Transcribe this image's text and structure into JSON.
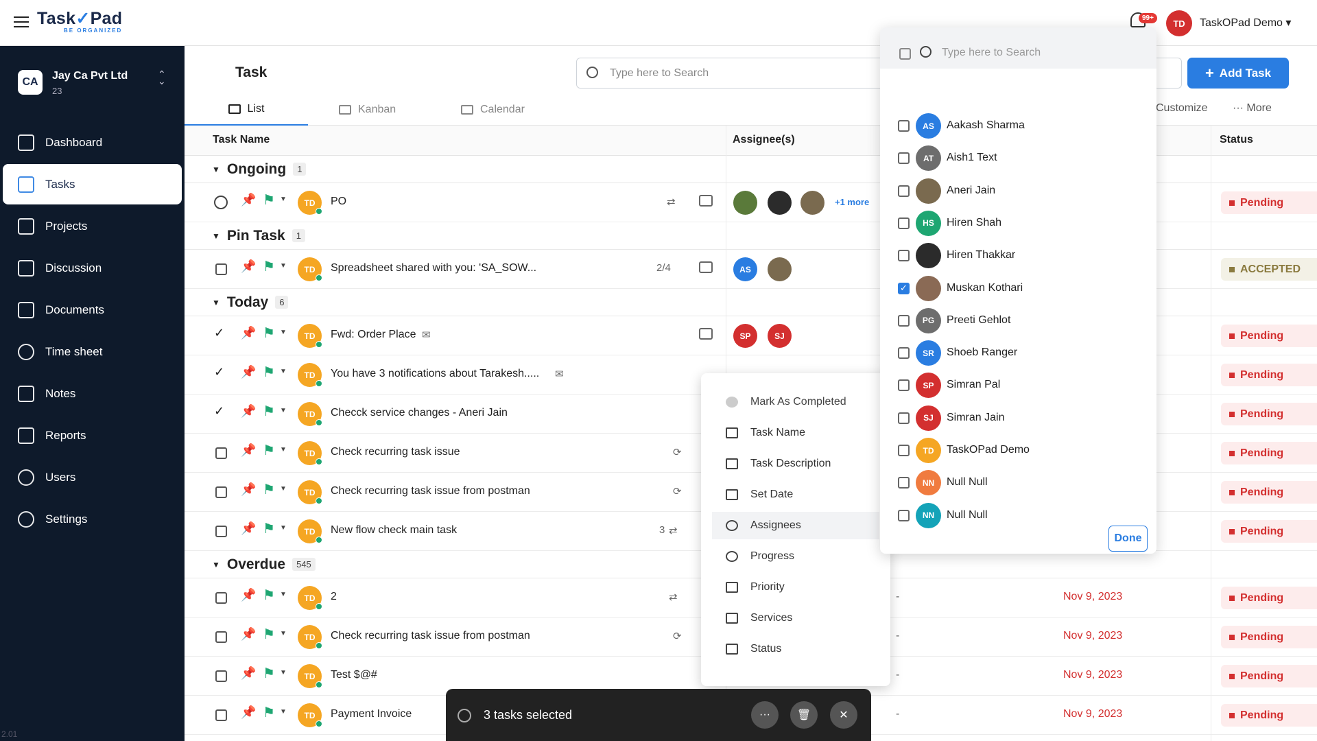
{
  "app": {
    "name_part1": "Task",
    "name_part2": "Pad",
    "tagline": "BE ORGANIZED",
    "version": "2.01"
  },
  "header": {
    "notification_badge": "99+",
    "user_initials": "TD",
    "user_name": "TaskOPad Demo ▾"
  },
  "sidebar": {
    "org_initials": "CA",
    "org_name": "Jay Ca Pvt Ltd",
    "org_count": "23",
    "items": [
      {
        "label": "Dashboard",
        "icon": "dashboard-icon"
      },
      {
        "label": "Tasks",
        "icon": "tasks-icon"
      },
      {
        "label": "Projects",
        "icon": "projects-icon"
      },
      {
        "label": "Discussion",
        "icon": "discussion-icon"
      },
      {
        "label": "Documents",
        "icon": "folder-icon"
      },
      {
        "label": "Time sheet",
        "icon": "clock-icon"
      },
      {
        "label": "Notes",
        "icon": "notes-icon"
      },
      {
        "label": "Reports",
        "icon": "reports-icon"
      },
      {
        "label": "Users",
        "icon": "users-icon"
      },
      {
        "label": "Settings",
        "icon": "gear-icon"
      }
    ]
  },
  "page": {
    "title": "Task",
    "search_placeholder": "Type here to Search",
    "add_task": "Add Task",
    "tabs": [
      "List",
      "Kanban",
      "Calendar"
    ],
    "customize": "Customize",
    "more": "··· More"
  },
  "columns": {
    "task_name": "Task Name",
    "assignees": "Assignee(s)",
    "status": "Status"
  },
  "groups": [
    {
      "name": "Ongoing",
      "count": "1"
    },
    {
      "name": "Pin Task",
      "count": "1"
    },
    {
      "name": "Today",
      "count": "6"
    },
    {
      "name": "Overdue",
      "count": "545"
    }
  ],
  "rows": [
    {
      "name": "PO",
      "assignee_more": "+1 more",
      "status": "Pending"
    },
    {
      "name": "Spreadsheet shared with you: 'SA_SOW...",
      "checklist": "2/4",
      "assignee1": "AS",
      "status": "ACCEPTED"
    },
    {
      "name": "Fwd: Order Place",
      "assignee1": "SP",
      "assignee2": "SJ",
      "status": "Pending"
    },
    {
      "name": "You have 3 notifications about Tarakesh.....",
      "status": "Pending"
    },
    {
      "name": "Checck service changes - Aneri Jain",
      "status": "Pending"
    },
    {
      "name": "Check recurring task issue",
      "status": "Pending"
    },
    {
      "name": "Check recurring task issue from postman",
      "status": "Pending"
    },
    {
      "name": "New flow check main task",
      "subtasks": "3",
      "status": "Pending"
    },
    {
      "name": "2",
      "dash": "-",
      "date": "Nov 9, 2023",
      "status": "Pending"
    },
    {
      "name": "Check recurring task issue from postman",
      "dash": "-",
      "date": "Nov 9, 2023",
      "status": "Pending"
    },
    {
      "name": "Test $@#",
      "dash": "-",
      "date": "Nov 9, 2023",
      "status": "Pending"
    },
    {
      "name": "Payment Invoice",
      "dash": "-",
      "date": "Nov 9, 2023",
      "status": "Pending"
    }
  ],
  "task_avatar": "TD",
  "context_menu": [
    "Mark As Completed",
    "Task Name",
    "Task Description",
    "Set Date",
    "Assignees",
    "Progress",
    "Priority",
    "Services",
    "Status"
  ],
  "assignee_popup": {
    "search_placeholder": "Type here to Search",
    "done": "Done",
    "people": [
      {
        "initials": "AS",
        "name": "Aakash Sharma",
        "color": "#2a7de1",
        "checked": false
      },
      {
        "initials": "AT",
        "name": "Aish1 Text",
        "color": "#6d6d6d",
        "checked": false
      },
      {
        "initials": "",
        "name": "Aneri Jain",
        "color": "#7a6a4f",
        "checked": false
      },
      {
        "initials": "HS",
        "name": "Hiren Shah",
        "color": "#1ea672",
        "checked": false
      },
      {
        "initials": "",
        "name": "Hiren Thakkar",
        "color": "#2b2b2b",
        "checked": false
      },
      {
        "initials": "",
        "name": "Muskan Kothari",
        "color": "#8a6a55",
        "checked": true
      },
      {
        "initials": "PG",
        "name": "Preeti Gehlot",
        "color": "#6d6d6d",
        "checked": false
      },
      {
        "initials": "SR",
        "name": "Shoeb Ranger",
        "color": "#2a7de1",
        "checked": false
      },
      {
        "initials": "SP",
        "name": "Simran Pal",
        "color": "#d32f2f",
        "checked": false
      },
      {
        "initials": "SJ",
        "name": "Simran Jain",
        "color": "#d32f2f",
        "checked": false
      },
      {
        "initials": "TD",
        "name": "TaskOPad Demo",
        "color": "#f5a623",
        "checked": false
      },
      {
        "initials": "NN",
        "name": "Null Null",
        "color": "#f07b3f",
        "checked": false
      },
      {
        "initials": "NN",
        "name": "Null Null",
        "color": "#14a3b8",
        "checked": false
      }
    ]
  },
  "selection_bar": {
    "text": "3 tasks selected",
    "more": "···",
    "close": "✕"
  }
}
